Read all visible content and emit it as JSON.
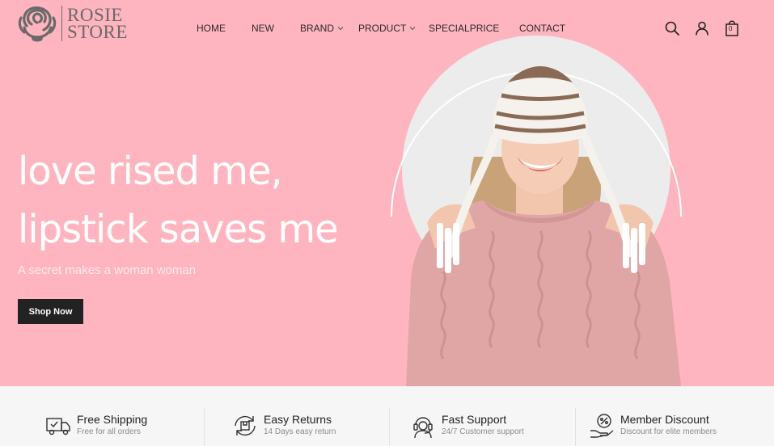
{
  "brand": {
    "line1": "ROSIE",
    "line2": "STORE"
  },
  "nav": [
    {
      "label": "HOME",
      "dropdown": false
    },
    {
      "label": "NEW",
      "dropdown": false
    },
    {
      "label": "BRAND",
      "dropdown": true
    },
    {
      "label": "PRODUCT",
      "dropdown": true
    },
    {
      "label": "SPECIALPRICE",
      "dropdown": false
    },
    {
      "label": "CONTACT",
      "dropdown": false
    }
  ],
  "header_icons": {
    "search": "search-icon",
    "account": "user-icon",
    "cart": "shopping-bag-icon",
    "cart_count": "0"
  },
  "hero": {
    "title_line1": "love rised me,",
    "title_line2": "lipstick saves me",
    "subtitle": "A secret makes a woman woman",
    "cta": "Shop Now"
  },
  "features": [
    {
      "icon": "truck-icon",
      "title": "Free Shipping",
      "desc": "Free for all orders"
    },
    {
      "icon": "return-box-icon",
      "title": "Easy Returns",
      "desc": "14 Days easy return"
    },
    {
      "icon": "headset-icon",
      "title": "Fast Support",
      "desc": "24/7 Customer support"
    },
    {
      "icon": "discount-hand-icon",
      "title": "Member Discount",
      "desc": "Discount for elite members"
    }
  ],
  "colors": {
    "background": "#ffb5bf",
    "button": "#222222",
    "features_bar": "#f6f6f6"
  }
}
